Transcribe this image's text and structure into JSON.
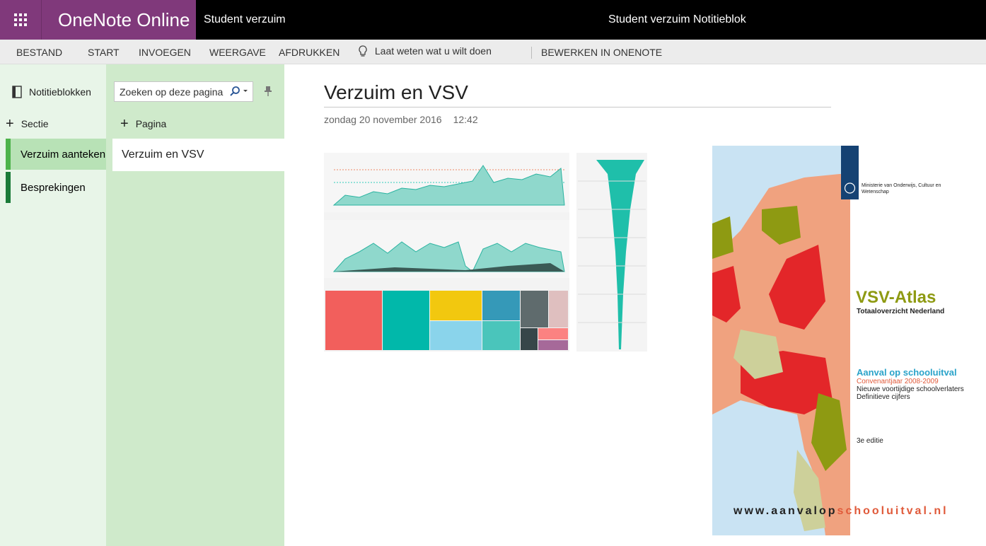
{
  "app": {
    "name": "OneNote Online",
    "notebook_short": "Student verzuim",
    "notebook_full": "Student verzuim Notitieblok"
  },
  "ribbon": {
    "tabs": [
      "BESTAND",
      "START",
      "INVOEGEN",
      "WEERGAVE",
      "AFDRUKKEN"
    ],
    "tell_me": "Laat weten wat u wilt doen",
    "edit_in": "BEWERKEN IN ONENOTE"
  },
  "leftnav": {
    "notebooks": "Notitieblokken",
    "add_section": "Sectie",
    "sections": [
      {
        "label": "Verzuim aanteken",
        "color": "#4db34a",
        "active": true
      },
      {
        "label": "Besprekingen",
        "color": "#1a7a38",
        "active": false
      }
    ]
  },
  "pages": {
    "search_placeholder": "Zoeken op deze pagina",
    "add_page": "Pagina",
    "items": [
      "Verzuim en VSV"
    ]
  },
  "page": {
    "title": "Verzuim en VSV",
    "date": "zondag 20 november 2016",
    "time": "12:42"
  },
  "cover": {
    "ministry": "Ministerie van Onderwijs, Cultuur en Wetenschap",
    "title": "VSV-Atlas",
    "subtitle": "Totaaloverzicht Nederland",
    "campaign": "Aanval op schooluitval",
    "period": "Convenantjaar 2008-2009",
    "line1": "Nieuwe voortijdige schoolverlaters",
    "line2": "Definitieve cijfers",
    "edition": "3e editie",
    "url_part1": "www.aanvalop",
    "url_part2": "schooluitval.nl"
  },
  "colors": {
    "purple": "#80397b",
    "teal": "#1fbfaa",
    "red": "#e32629"
  }
}
